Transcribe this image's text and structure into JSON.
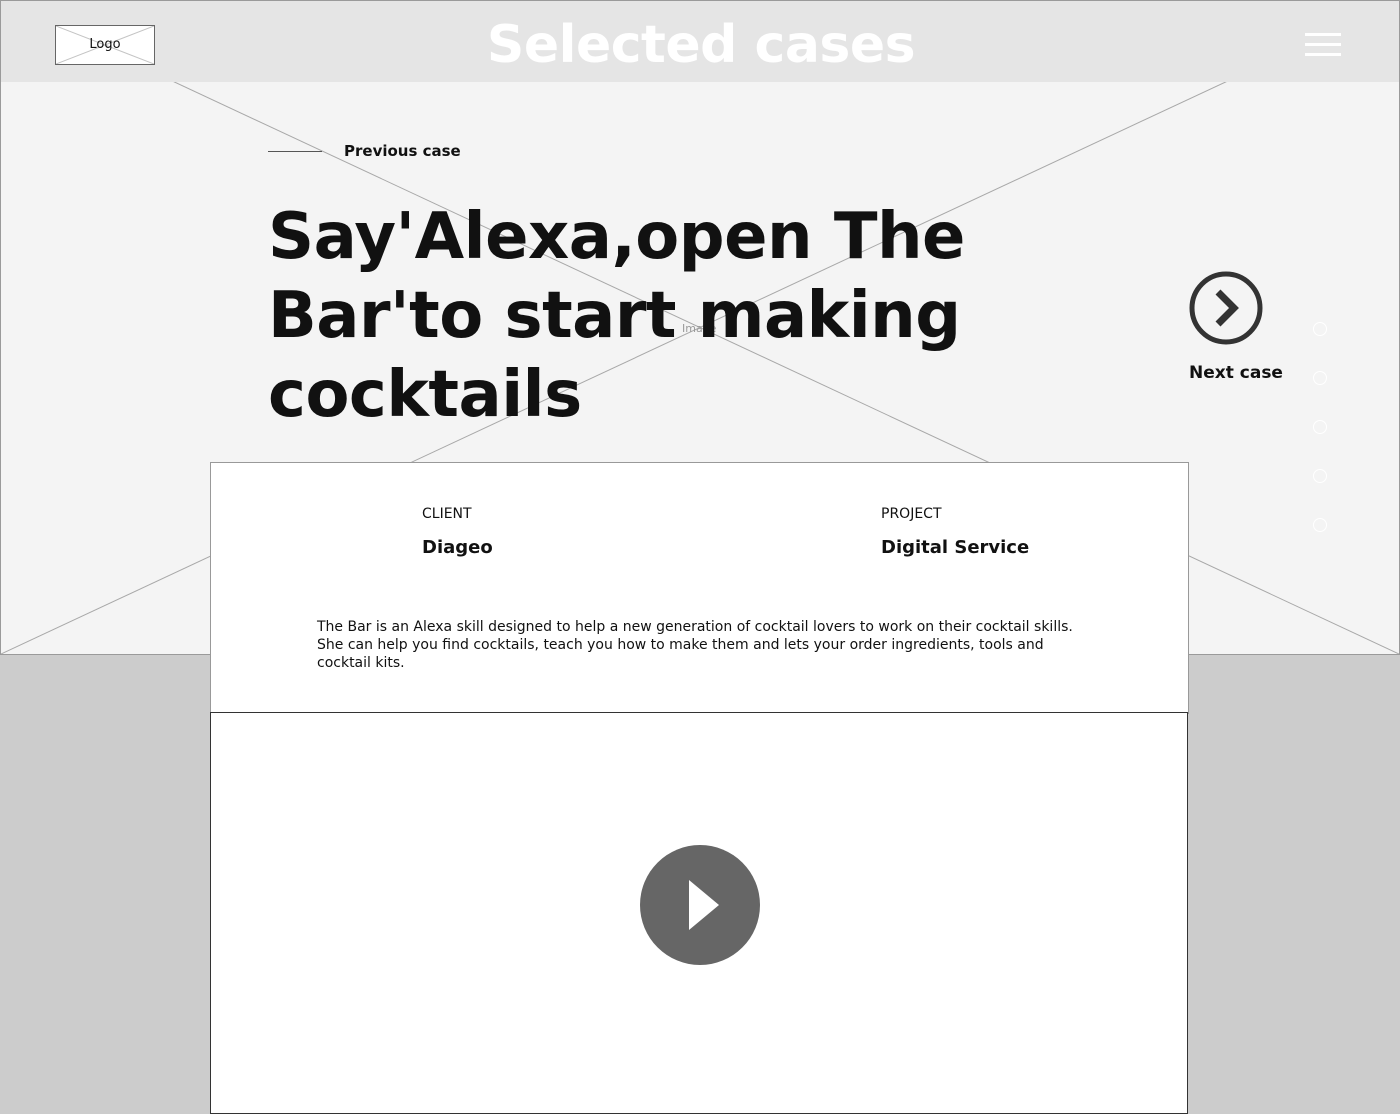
{
  "header": {
    "logo_label": "Logo",
    "title": "Selected cases",
    "menu_icon": "hamburger-menu-icon"
  },
  "hero": {
    "image_placeholder_label": "Image",
    "previous_label": "Previous case",
    "headline": "Say'Alexa,open The Bar'to start making cocktails",
    "next_label": "Next case",
    "next_icon": "chevron-right-circle-icon",
    "pagination_count": 5
  },
  "case_info": {
    "client_label": "CLIENT",
    "client_value": "Diageo",
    "project_label": "PROJECT",
    "project_value": "Digital Service",
    "description": "The Bar is an Alexa skill designed to help a new generation of cocktail lovers to work on their cocktail skills. She can help you find cocktails, teach you how to make them and lets your order ingredients, tools and cocktail kits."
  },
  "video": {
    "play_icon": "play-icon"
  },
  "colors": {
    "page_background": "#cccccc",
    "hero_background": "#f4f4f4",
    "header_background": "#e5e5e5",
    "play_button": "#666666",
    "text": "#111111"
  }
}
